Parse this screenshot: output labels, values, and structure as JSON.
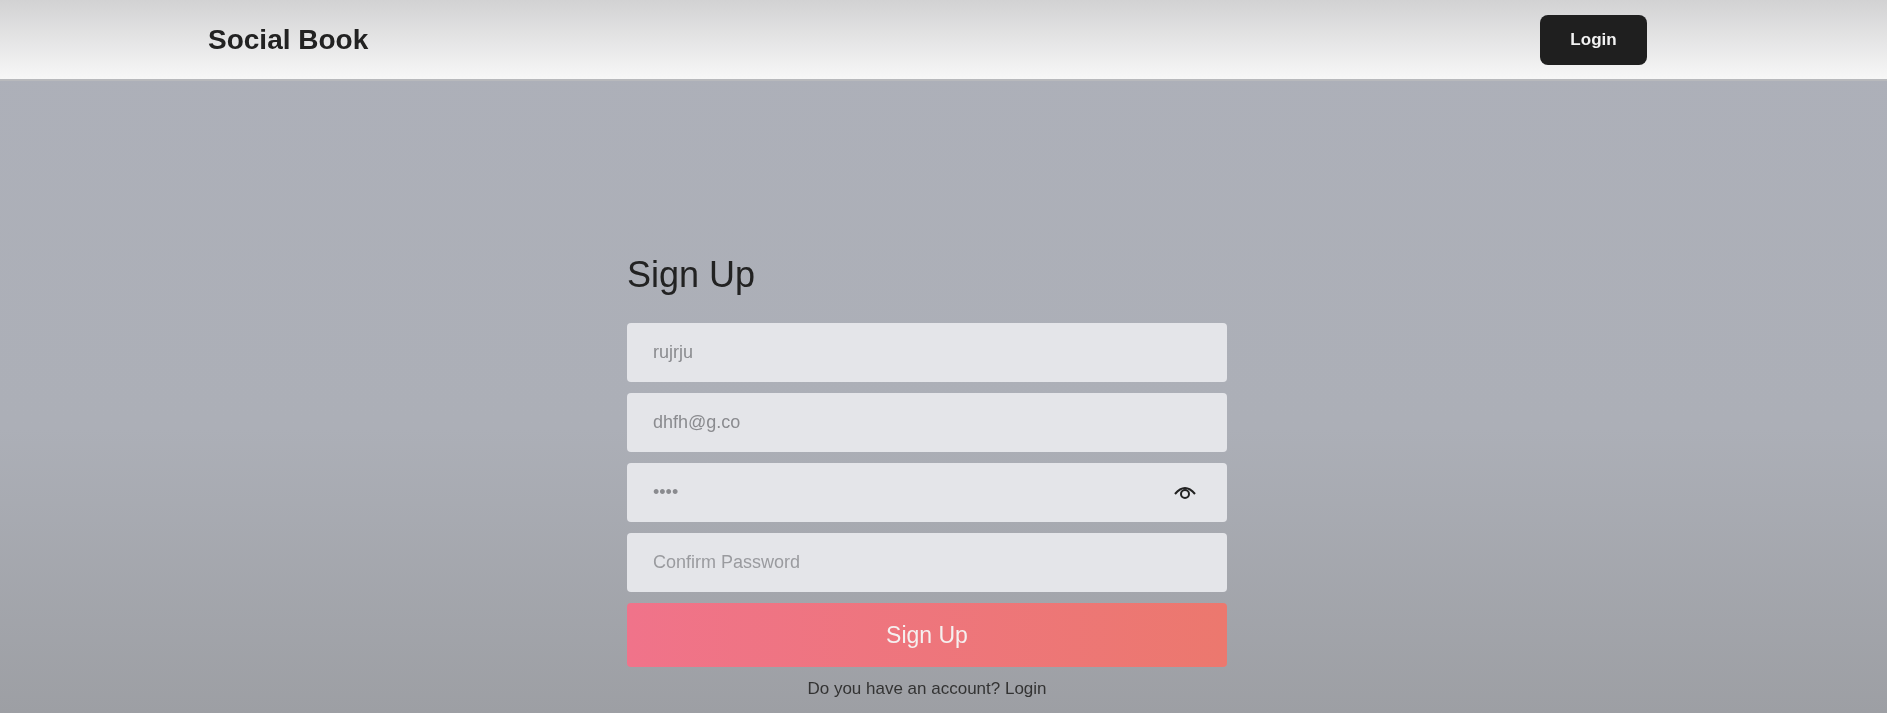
{
  "header": {
    "title": "Social Book",
    "login_button": "Login"
  },
  "form": {
    "heading": "Sign Up",
    "fields": [
      {
        "kind": "text",
        "value": "rujrju"
      },
      {
        "kind": "text",
        "value": "dhfh@g.co"
      },
      {
        "kind": "password",
        "value": "••••"
      },
      {
        "kind": "text",
        "placeholder": "Confirm Password"
      }
    ],
    "submit_button": "Sign Up",
    "footer_text": "Do you have an account? Login"
  }
}
